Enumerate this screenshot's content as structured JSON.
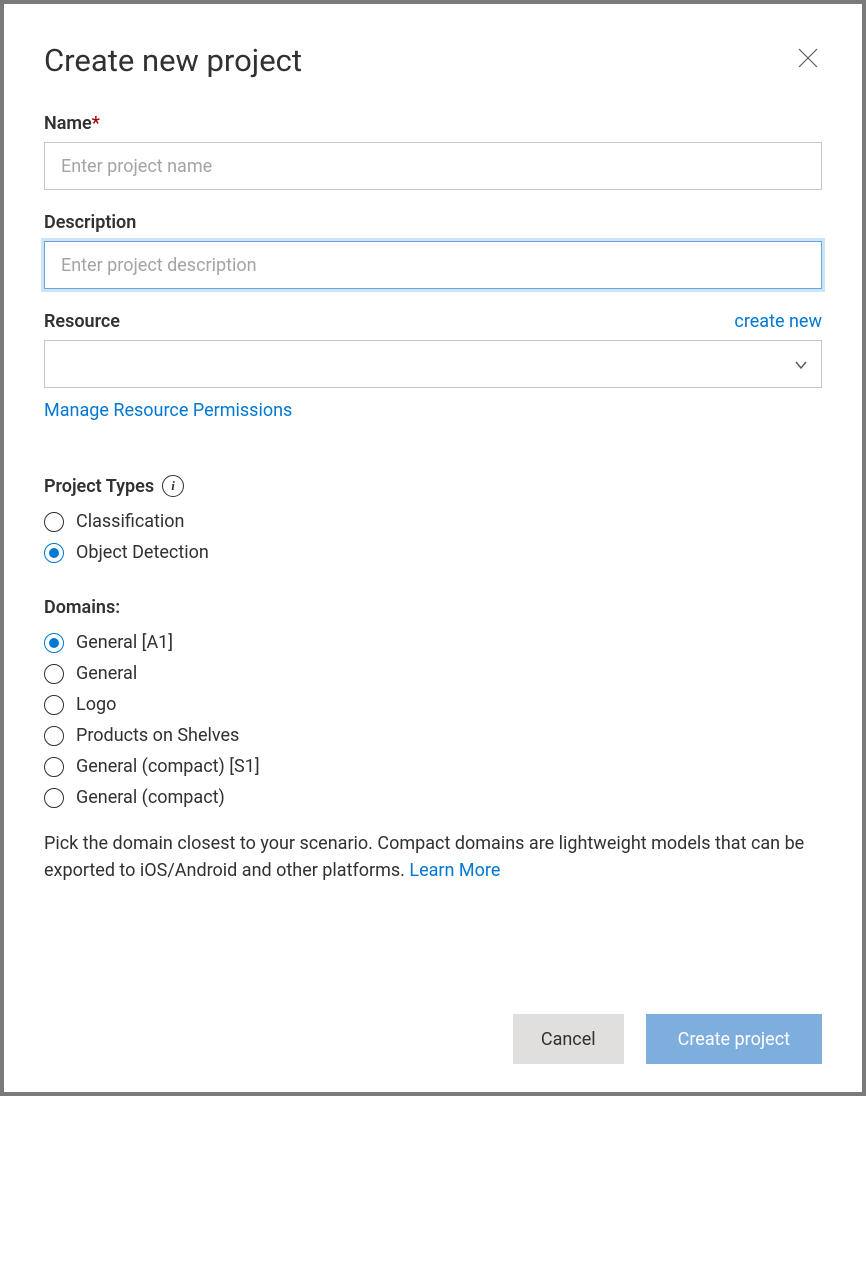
{
  "dialog": {
    "title": "Create new project",
    "close_aria": "Close"
  },
  "name": {
    "label": "Name",
    "required_mark": "*",
    "placeholder": "Enter project name",
    "value": ""
  },
  "description": {
    "label": "Description",
    "placeholder": "Enter project description",
    "value": ""
  },
  "resource": {
    "label": "Resource",
    "create_new": "create new",
    "selected": "",
    "manage_link": "Manage Resource Permissions"
  },
  "project_types": {
    "label": "Project Types",
    "info_glyph": "i",
    "options": [
      {
        "label": "Classification",
        "checked": false
      },
      {
        "label": "Object Detection",
        "checked": true
      }
    ]
  },
  "domains": {
    "label": "Domains:",
    "options": [
      {
        "label": "General [A1]",
        "checked": true
      },
      {
        "label": "General",
        "checked": false
      },
      {
        "label": "Logo",
        "checked": false
      },
      {
        "label": "Products on Shelves",
        "checked": false
      },
      {
        "label": "General (compact) [S1]",
        "checked": false
      },
      {
        "label": "General (compact)",
        "checked": false
      }
    ],
    "help_text": "Pick the domain closest to your scenario. Compact domains are lightweight models that can be exported to iOS/Android and other platforms. ",
    "learn_more": "Learn More"
  },
  "footer": {
    "cancel": "Cancel",
    "create": "Create project"
  }
}
